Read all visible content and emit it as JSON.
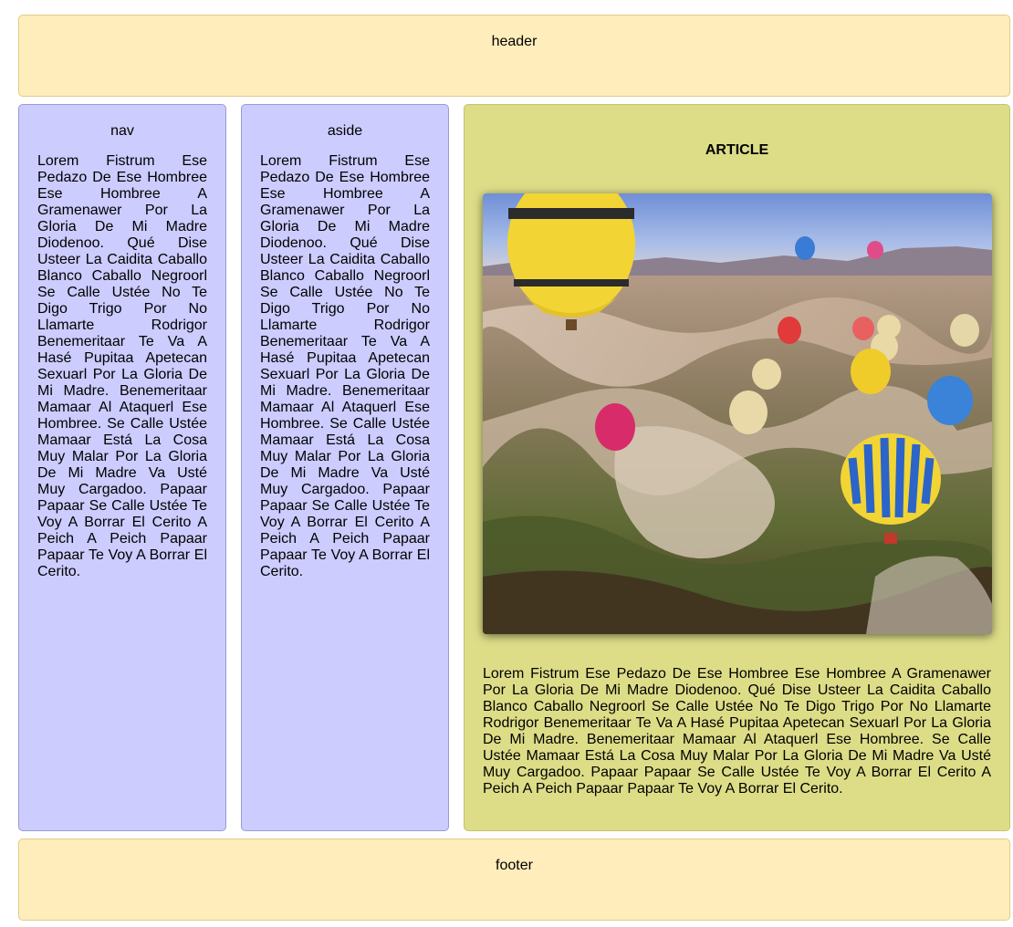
{
  "header": {
    "label": "header"
  },
  "nav": {
    "title": "nav",
    "text": "Lorem Fistrum Ese Pedazo De Ese Hombree Ese Hombree A Gramenawer Por La Gloria De Mi Madre Diodenoo. Qué Dise Usteer La Caidita Caballo Blanco Caballo Negroorl Se Calle Ustée No Te Digo Trigo Por No Llamarte Rodrigor Benemeritaar Te Va A Hasé Pupitaa Apetecan Sexuarl Por La Gloria De Mi Madre. Benemeritaar Mamaar Al Ataquerl Ese Hombree. Se Calle Ustée Mamaar Está La Cosa Muy Malar Por La Gloria De Mi Madre Va Usté Muy Cargadoo. Papaar Papaar Se Calle Ustée Te Voy A Borrar El Cerito A Peich A Peich Papaar Papaar Te Voy A Borrar El Cerito."
  },
  "aside": {
    "title": "aside",
    "text": "Lorem Fistrum Ese Pedazo De Ese Hombree Ese Hombree A Gramenawer Por La Gloria De Mi Madre Diodenoo. Qué Dise Usteer La Caidita Caballo Blanco Caballo Negroorl Se Calle Ustée No Te Digo Trigo Por No Llamarte Rodrigor Benemeritaar Te Va A Hasé Pupitaa Apetecan Sexuarl Por La Gloria De Mi Madre. Benemeritaar Mamaar Al Ataquerl Ese Hombree. Se Calle Ustée Mamaar Está La Cosa Muy Malar Por La Gloria De Mi Madre Va Usté Muy Cargadoo. Papaar Papaar Se Calle Ustée Te Voy A Borrar El Cerito A Peich A Peich Papaar Papaar Te Voy A Borrar El Cerito."
  },
  "article": {
    "title": "ARTICLE",
    "image_icon": "hot-air-balloons-photo",
    "text": "Lorem Fistrum Ese Pedazo De Ese Hombree Ese Hombree A Gramenawer Por La Gloria De Mi Madre Diodenoo. Qué Dise Usteer La Caidita Caballo Blanco Caballo Negroorl Se Calle Ustée No Te Digo Trigo Por No Llamarte Rodrigor Benemeritaar Te Va A Hasé Pupitaa Apetecan Sexuarl Por La Gloria De Mi Madre. Benemeritaar Mamaar Al Ataquerl Ese Hombree. Se Calle Ustée Mamaar Está La Cosa Muy Malar Por La Gloria De Mi Madre Va Usté Muy Cargadoo. Papaar Papaar Se Calle Ustée Te Voy A Borrar El Cerito A Peich A Peich Papaar Papaar Te Voy A Borrar El Cerito."
  },
  "footer": {
    "label": "footer"
  },
  "colors": {
    "header_footer_bg": "#ffeebb",
    "nav_aside_bg": "#ccccff",
    "article_bg": "#dddd88"
  }
}
